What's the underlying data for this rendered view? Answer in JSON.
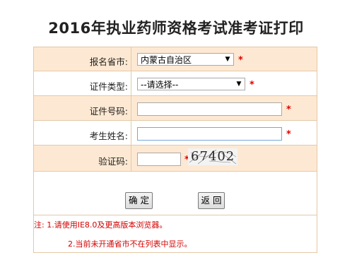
{
  "title": "2016年执业药师资格考试准考证打印",
  "form": {
    "province": {
      "label": "报名省市:",
      "value": "内蒙古自治区"
    },
    "id_type": {
      "label": "证件类型:",
      "value": "--请选择--"
    },
    "id_number": {
      "label": "证件号码:",
      "value": ""
    },
    "name": {
      "label": "考生姓名:",
      "value": ""
    },
    "captcha": {
      "label": "验证码:",
      "value": "",
      "image_text": "67402"
    },
    "required_mark": "*"
  },
  "buttons": {
    "confirm": "确 定",
    "back": "返 回"
  },
  "notes": {
    "line1": "注: 1.请使用IE8.0及更高版本浏览器。",
    "line2": "2.当前未开通省市不在列表中显示。"
  }
}
